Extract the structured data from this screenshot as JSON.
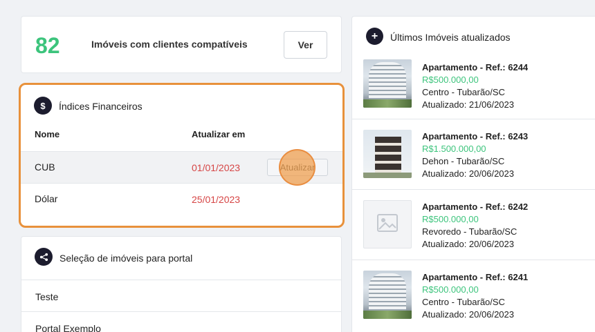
{
  "compat": {
    "count": "82",
    "label": "Imóveis com clientes compatíveis",
    "button": "Ver"
  },
  "indices": {
    "icon": "dollar-icon",
    "title": "Índices Financeiros",
    "col_name": "Nome",
    "col_update": "Atualizar em",
    "rows": [
      {
        "name": "CUB",
        "date": "01/01/2023",
        "action": "Atualizar"
      },
      {
        "name": "Dólar",
        "date": "25/01/2023"
      }
    ],
    "date_color": "#d64545"
  },
  "portal": {
    "icon": "share-icon",
    "title": "Seleção de imóveis para portal",
    "items": [
      "Teste",
      "Portal Exemplo"
    ]
  },
  "latest": {
    "icon": "plus-icon",
    "title": "Últimos Imóveis atualizados",
    "items": [
      {
        "title": "Apartamento - Ref.: 6244",
        "price": "R$500.000,00",
        "location": "Centro - Tubarão/SC",
        "updated": "Atualizado: 21/06/2023"
      },
      {
        "title": "Apartamento - Ref.: 6243",
        "price": "R$1.500.000,00",
        "location": "Dehon - Tubarão/SC",
        "updated": "Atualizado: 20/06/2023"
      },
      {
        "title": "Apartamento - Ref.: 6242",
        "price": "R$500.000,00",
        "location": "Revoredo - Tubarão/SC",
        "updated": "Atualizado: 20/06/2023"
      },
      {
        "title": "Apartamento - Ref.: 6241",
        "price": "R$500.000,00",
        "location": "Centro - Tubarão/SC",
        "updated": "Atualizado: 20/06/2023"
      }
    ]
  },
  "colors": {
    "accent_green": "#3cc47c",
    "highlight_orange": "#e8913b",
    "icon_dark": "#1c1c2e"
  }
}
